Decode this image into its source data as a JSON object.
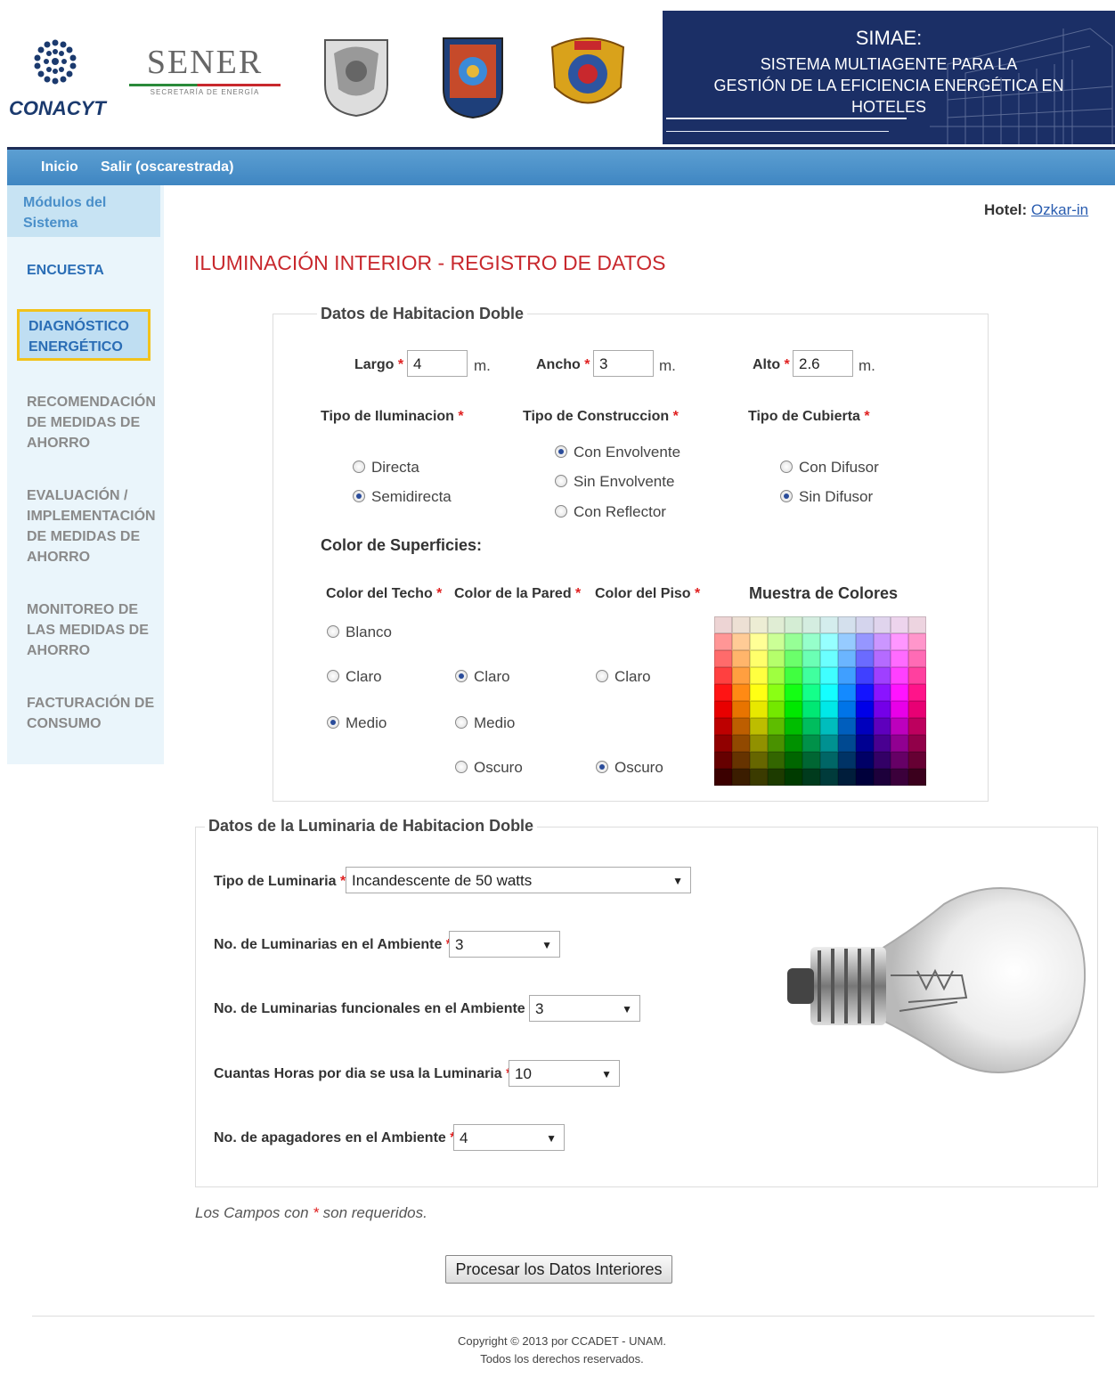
{
  "header": {
    "conacyt": "CONACYT",
    "sener": "SENER",
    "sener_sub": "SECRETARÍA DE ENERGÍA",
    "simae_title": "SIMAE:",
    "simae_line1": "SISTEMA MULTIAGENTE PARA LA",
    "simae_line2": "GESTIÓN DE LA EFICIENCIA ENERGÉTICA EN",
    "simae_line3": "HOTELES"
  },
  "nav": {
    "home": "Inicio",
    "logout": "Salir (oscarestrada)"
  },
  "sidebar": {
    "title": "Módulos del Sistema",
    "items": [
      "ENCUESTA",
      "DIAGNÓSTICO ENERGÉTICO",
      "RECOMENDACIÓN DE MEDIDAS DE AHORRO",
      "EVALUACIÓN / IMPLEMENTACIÓN DE MEDIDAS DE AHORRO",
      "MONITOREO DE LAS MEDIDAS DE AHORRO",
      "FACTURACIÓN DE CONSUMO"
    ]
  },
  "hotel": {
    "label": "Hotel:",
    "name": "Ozkar-in"
  },
  "page_title": "ILUMINACIÓN INTERIOR - REGISTRO DE DATOS",
  "room": {
    "legend": "Datos de Habitacion Doble",
    "largo_label": "Largo",
    "largo_value": "4",
    "ancho_label": "Ancho",
    "ancho_value": "3",
    "alto_label": "Alto",
    "alto_value": "2.6",
    "unit": "m.",
    "tipo_iluminacion": "Tipo de Iluminacion",
    "ilum_opts": [
      "Directa",
      "Semidirecta"
    ],
    "tipo_construccion": "Tipo de Construccion",
    "const_opts": [
      "Con Envolvente",
      "Sin Envolvente",
      "Con Reflector"
    ],
    "tipo_cubierta": "Tipo de Cubierta",
    "cub_opts": [
      "Con Difusor",
      "Sin Difusor"
    ],
    "color_superficies": "Color de Superficies:",
    "color_techo": "Color del Techo",
    "color_pared": "Color de la Pared",
    "color_piso": "Color del Piso",
    "muestra": "Muestra de Colores",
    "techo_opts": [
      "Blanco",
      "Claro",
      "Medio"
    ],
    "pared_opts": [
      "Claro",
      "Medio",
      "Oscuro"
    ],
    "piso_opts": [
      "Claro",
      "Oscuro"
    ]
  },
  "luminaria": {
    "legend": "Datos de la Luminaria de Habitacion Doble",
    "tipo_label": "Tipo de Luminaria",
    "tipo_value": "Incandescente de 50 watts",
    "num_label": "No. de Luminarias en el Ambiente",
    "num_value": "3",
    "func_label": "No. de Luminarias funcionales en el Ambiente",
    "func_value": "3",
    "horas_label": "Cuantas Horas por dia se usa la Luminaria",
    "horas_value": "10",
    "apag_label": "No. de apagadores en el Ambiente",
    "apag_value": "4"
  },
  "required_note_a": "Los Campos con",
  "required_note_b": "son requeridos.",
  "submit": "Procesar los Datos Interiores",
  "footer": {
    "line1": "Copyright © 2013 por CCADET - UNAM.",
    "line2": "Todos los derechos reservados."
  },
  "colors": {
    "accent_red": "#c8282d",
    "nav_blue": "#4a8fc9",
    "header_navy": "#1b2f66",
    "link_blue": "#2a5db0"
  }
}
